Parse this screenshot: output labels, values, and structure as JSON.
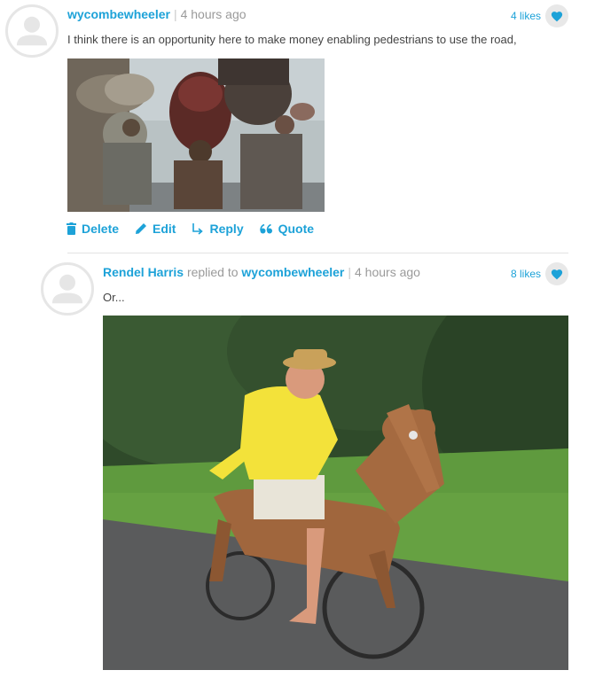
{
  "comment1": {
    "author": "wycombewheeler",
    "time": "4 hours ago",
    "likes": "4 likes",
    "text": "I think there is an opportunity here to make money enabling pedestrians to use the road,",
    "actions": {
      "delete": "Delete",
      "edit": "Edit",
      "reply": "Reply",
      "quote": "Quote"
    }
  },
  "comment2": {
    "author": "Rendel Harris",
    "replied_to_text": "replied to",
    "replied_to": "wycombewheeler",
    "time": "4 hours ago",
    "likes": "8 likes",
    "text": "Or..."
  },
  "colors": {
    "accent": "#1da2d8",
    "muted": "#9a9a9a"
  },
  "icons": [
    "avatar-placeholder-icon",
    "heart-icon",
    "trash-icon",
    "pencil-icon",
    "reply-arrow-icon",
    "quote-icon"
  ]
}
